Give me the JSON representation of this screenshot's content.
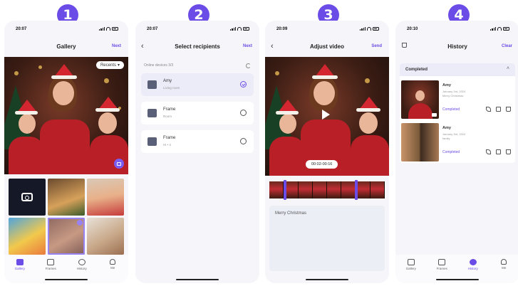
{
  "steps": [
    "1",
    "2",
    "3",
    "4"
  ],
  "screen1": {
    "time": "20:07",
    "title": "Gallery",
    "action": "Next",
    "recents_label": "Recents",
    "tabs": [
      {
        "label": "Gallery",
        "icon": "gallery-icon",
        "active": true
      },
      {
        "label": "Frames",
        "icon": "frames-icon",
        "active": false
      },
      {
        "label": "History",
        "icon": "history-icon",
        "active": false
      },
      {
        "label": "Me",
        "icon": "person-icon",
        "active": false
      }
    ]
  },
  "screen2": {
    "time": "20:07",
    "title": "Select recipients",
    "action": "Next",
    "online_label": "Online devices  3/3",
    "recipients": [
      {
        "name": "Amy",
        "sub": "Living room",
        "selected": true
      },
      {
        "name": "Frame",
        "sub": "Room",
        "selected": false
      },
      {
        "name": "Frame",
        "sub": "Hi • 4",
        "selected": false
      }
    ]
  },
  "screen3": {
    "time": "20:09",
    "title": "Adjust video",
    "action": "Send",
    "timecode": "00:02-00:16",
    "message": "Merry Christmas"
  },
  "screen4": {
    "time": "20:10",
    "title": "History",
    "action": "Clear",
    "section": "Completed",
    "items": [
      {
        "name": "Amy",
        "date": "January 3rd, 2024",
        "note": "Merry Christmas",
        "status": "Completed"
      },
      {
        "name": "Amy",
        "date": "January 3rd, 2024",
        "note": "family",
        "status": "Completed"
      }
    ],
    "tabs": [
      {
        "label": "Gallery",
        "icon": "gallery-icon",
        "active": false
      },
      {
        "label": "Frames",
        "icon": "frames-icon",
        "active": false
      },
      {
        "label": "History",
        "icon": "history-icon",
        "active": true
      },
      {
        "label": "Me",
        "icon": "person-icon",
        "active": false
      }
    ]
  },
  "colors": {
    "accent": "#6b4ce6",
    "background": "#f6f6fa"
  }
}
